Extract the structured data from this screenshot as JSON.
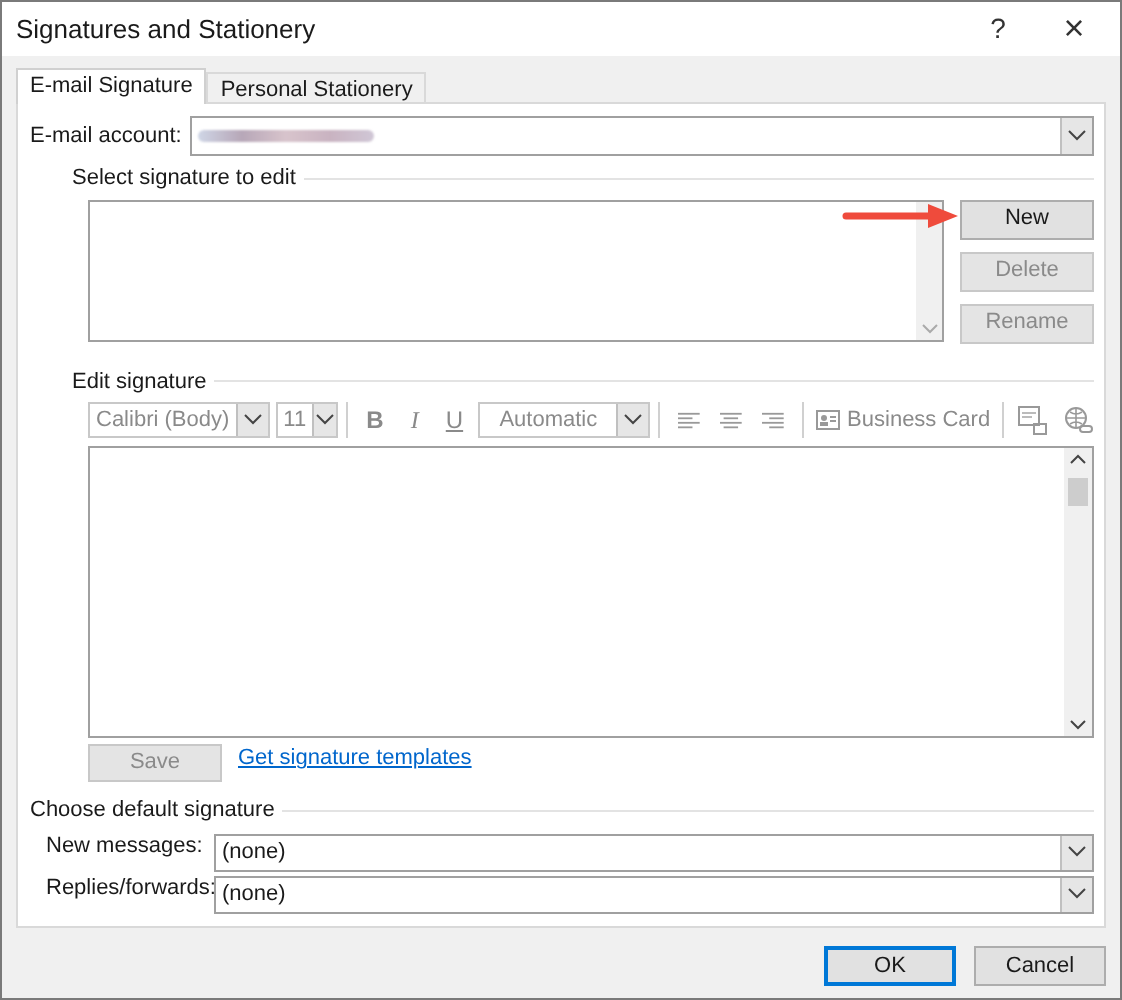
{
  "window": {
    "title": "Signatures and Stationery",
    "help": "?",
    "close": "×"
  },
  "tabs": [
    {
      "label": "E-mail Signature",
      "selected": true
    },
    {
      "label": "Personal Stationery",
      "selected": false
    }
  ],
  "email_account": {
    "label": "E-mail account:",
    "value_redacted": true
  },
  "select_signature": {
    "heading": "Select signature to edit",
    "buttons": [
      {
        "label": "New",
        "disabled": false
      },
      {
        "label": "Delete",
        "disabled": true
      },
      {
        "label": "Rename",
        "disabled": true
      }
    ]
  },
  "edit_signature": {
    "heading": "Edit signature",
    "toolbar": {
      "disabled": true,
      "font": "Calibri (Body)",
      "size": "11",
      "bold": "B",
      "italic": "I",
      "underline": "U",
      "color_label": "Automatic",
      "business_card": "Business Card"
    },
    "save": {
      "label": "Save",
      "disabled": true
    },
    "link": "Get signature templates"
  },
  "defaults": {
    "heading": "Choose default signature",
    "fields": [
      {
        "label": "New messages:",
        "value": "(none)"
      },
      {
        "label": "Replies/forwards:",
        "value": "(none)"
      }
    ]
  },
  "footer": [
    {
      "label": "OK",
      "default": true
    },
    {
      "label": "Cancel",
      "default": false
    }
  ]
}
